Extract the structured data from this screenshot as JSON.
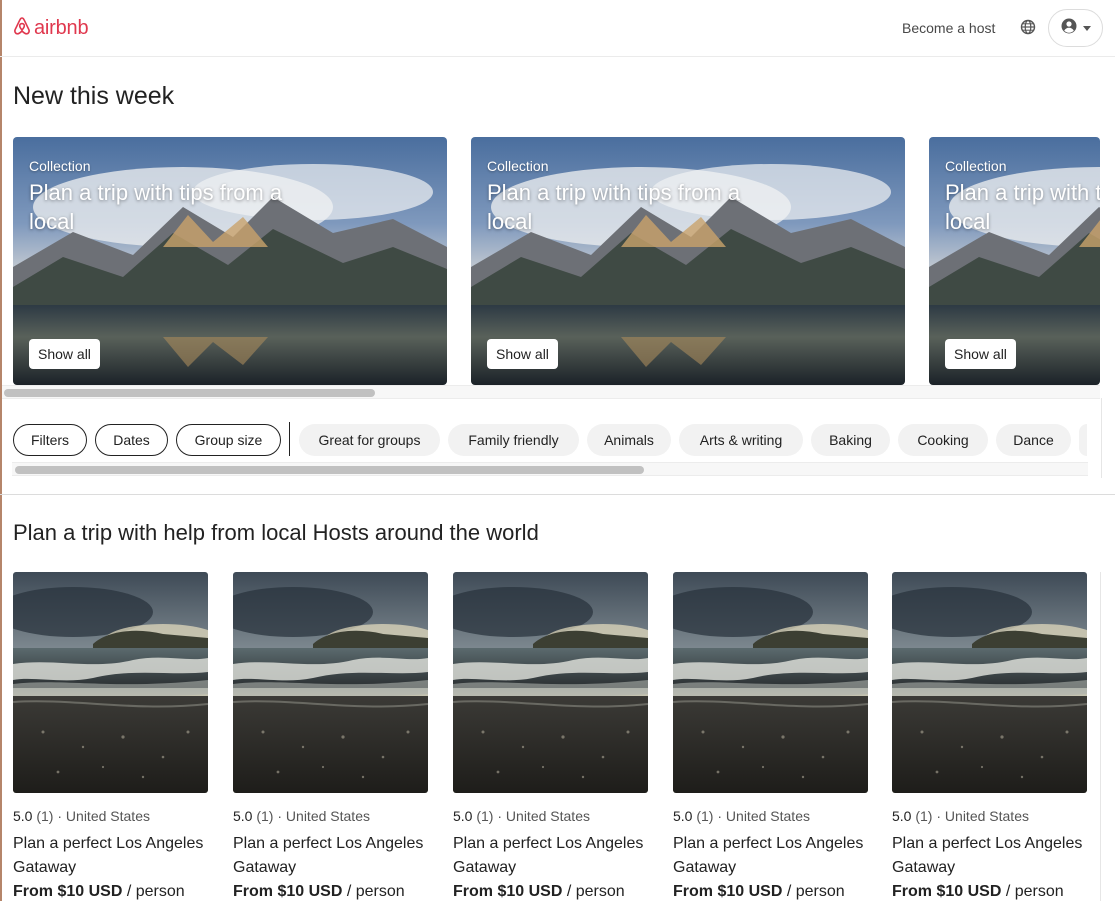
{
  "header": {
    "logo_text": "airbnb",
    "become_host": "Become a host",
    "brand_color": "#e0384e"
  },
  "new_this_week": {
    "title": "New this week",
    "collections": [
      {
        "kicker": "Collection",
        "title": "Plan a trip with tips from a local",
        "button": "Show all"
      },
      {
        "kicker": "Collection",
        "title": "Plan a trip with tips from a local",
        "button": "Show all"
      },
      {
        "kicker": "Collection",
        "title": "Plan a trip with tips from a local",
        "button": "Show all"
      }
    ]
  },
  "filters": {
    "outlined": [
      "Filters",
      "Dates",
      "Group size"
    ],
    "categories": [
      "Great for groups",
      "Family friendly",
      "Animals",
      "Arts & writing",
      "Baking",
      "Cooking",
      "Dance"
    ]
  },
  "local_hosts": {
    "title": "Plan a trip with help from local Hosts around the world",
    "cards": [
      {
        "rating": "5.0",
        "count": "(1)",
        "location": "· United States",
        "title": "Plan a perfect Los Angeles Gataway",
        "price": "From $10 USD",
        "unit": " / person"
      },
      {
        "rating": "5.0",
        "count": "(1)",
        "location": "· United States",
        "title": "Plan a perfect Los Angeles Gataway",
        "price": "From $10 USD",
        "unit": " / person"
      },
      {
        "rating": "5.0",
        "count": "(1)",
        "location": "· United States",
        "title": "Plan a perfect Los Angeles Gataway",
        "price": "From $10 USD",
        "unit": " / person"
      },
      {
        "rating": "5.0",
        "count": "(1)",
        "location": "· United States",
        "title": "Plan a perfect Los Angeles Gataway",
        "price": "From $10 USD",
        "unit": " / person"
      },
      {
        "rating": "5.0",
        "count": "(1)",
        "location": "· United States",
        "title": "Plan a perfect Los Angeles Gataway",
        "price": "From $10 USD",
        "unit": " / person"
      }
    ]
  }
}
